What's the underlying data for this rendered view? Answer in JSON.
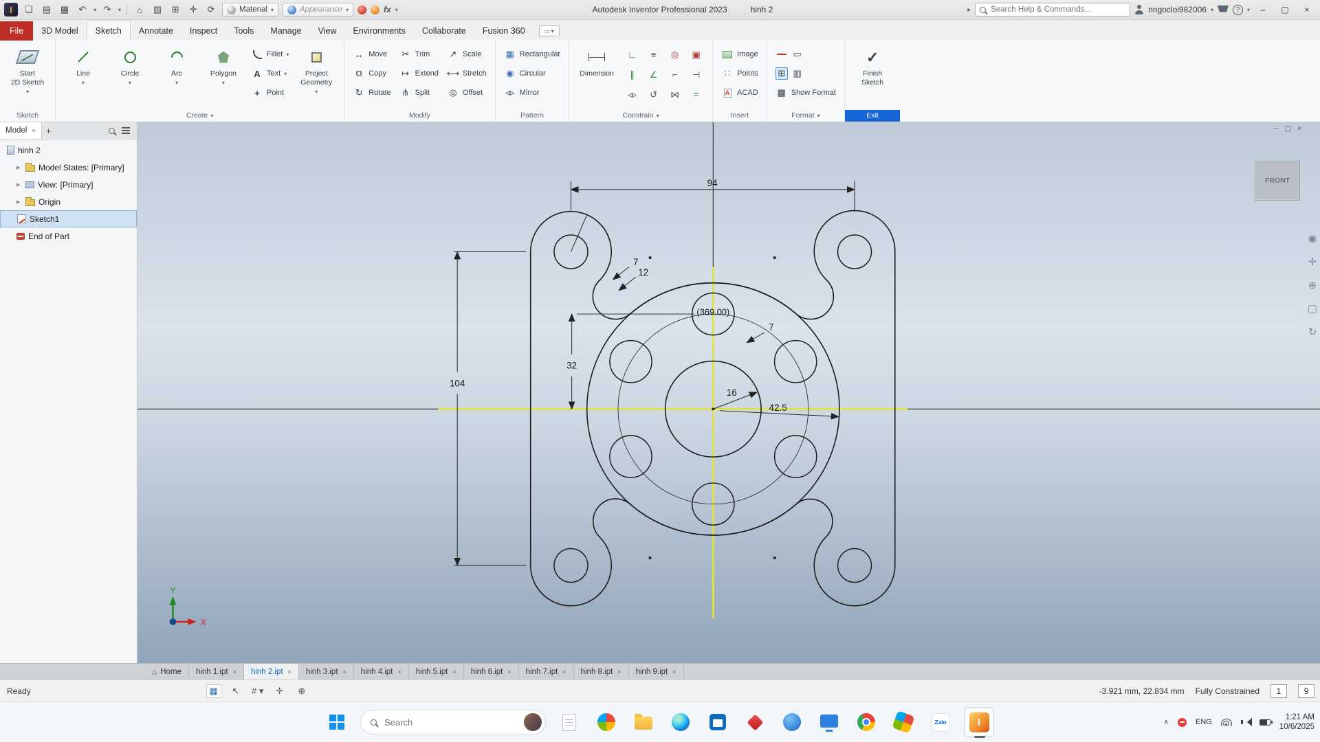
{
  "titlebar": {
    "app_title": "Autodesk Inventor Professional 2023",
    "doc_title": "hinh 2",
    "material_label": "Material",
    "appearance_label": "Appearance",
    "fx_label": "fx",
    "search_placeholder": "Search Help & Commands...",
    "user_name": "nngocloi982006"
  },
  "menubar": {
    "file": "File",
    "tabs": [
      "3D Model",
      "Sketch",
      "Annotate",
      "Inspect",
      "Tools",
      "Manage",
      "View",
      "Environments",
      "Collaborate",
      "Fusion 360"
    ]
  },
  "ribbon": {
    "groups": {
      "sketch": {
        "label": "Sketch",
        "start2d_line1": "Start",
        "start2d_line2": "2D Sketch"
      },
      "create": {
        "label": "Create",
        "line": "Line",
        "circle": "Circle",
        "arc": "Arc",
        "polygon": "Polygon",
        "fillet": "Fillet",
        "text": "Text",
        "point": "Point",
        "project_line1": "Project",
        "project_line2": "Geometry"
      },
      "modify": {
        "label": "Modify",
        "move": "Move",
        "copy": "Copy",
        "rotate": "Rotate",
        "trim": "Trim",
        "extend": "Extend",
        "split": "Split",
        "scale": "Scale",
        "stretch": "Stretch",
        "offset": "Offset"
      },
      "pattern": {
        "label": "Pattern",
        "rectangular": "Rectangular",
        "circular": "Circular",
        "mirror": "Mirror"
      },
      "constrain": {
        "label": "Constrain",
        "dimension": "Dimension"
      },
      "insert": {
        "label": "Insert",
        "image": "Image",
        "points": "Points",
        "acad": "ACAD"
      },
      "format": {
        "label": "Format",
        "show_format": "Show Format"
      },
      "exit": {
        "label": "Exit",
        "finish_line1": "Finish",
        "finish_line2": "Sketch"
      }
    }
  },
  "browser": {
    "tab_label": "Model",
    "tree": [
      {
        "label": "hinh 2"
      },
      {
        "label": "Model States: [Primary]"
      },
      {
        "label": "View: [Primary]"
      },
      {
        "label": "Origin"
      },
      {
        "label": "Sketch1"
      },
      {
        "label": "End of Part"
      }
    ]
  },
  "viewport": {
    "viewcube": "FRONT",
    "dims": {
      "d94": "94",
      "d104": "104",
      "d32": "32",
      "d369": "(369.00)",
      "d7a": "7",
      "d7b": "7",
      "d12": "12",
      "d16": "16",
      "d425": "42.5"
    },
    "axes": {
      "x": "X",
      "y": "Y"
    }
  },
  "doctabs": {
    "home": "Home",
    "tabs": [
      "hinh 1.ipt",
      "hinh 2.ipt",
      "hinh 3.ipt",
      "hinh 4.ipt",
      "hinh 5.ipt",
      "hinh 6.ipt",
      "hinh 7.ipt",
      "hinh 8.ipt",
      "hinh 9.ipt"
    ]
  },
  "statusbar": {
    "ready": "Ready",
    "coords": "-3.921 mm, 22.834 mm",
    "constrained": "Fully Constrained",
    "box1": "1",
    "box2": "9"
  },
  "taskbar": {
    "search_placeholder": "Search",
    "zalo": "Zalo",
    "lang": "ENG",
    "time": "1:21 AM",
    "date": "10/6/2025"
  }
}
